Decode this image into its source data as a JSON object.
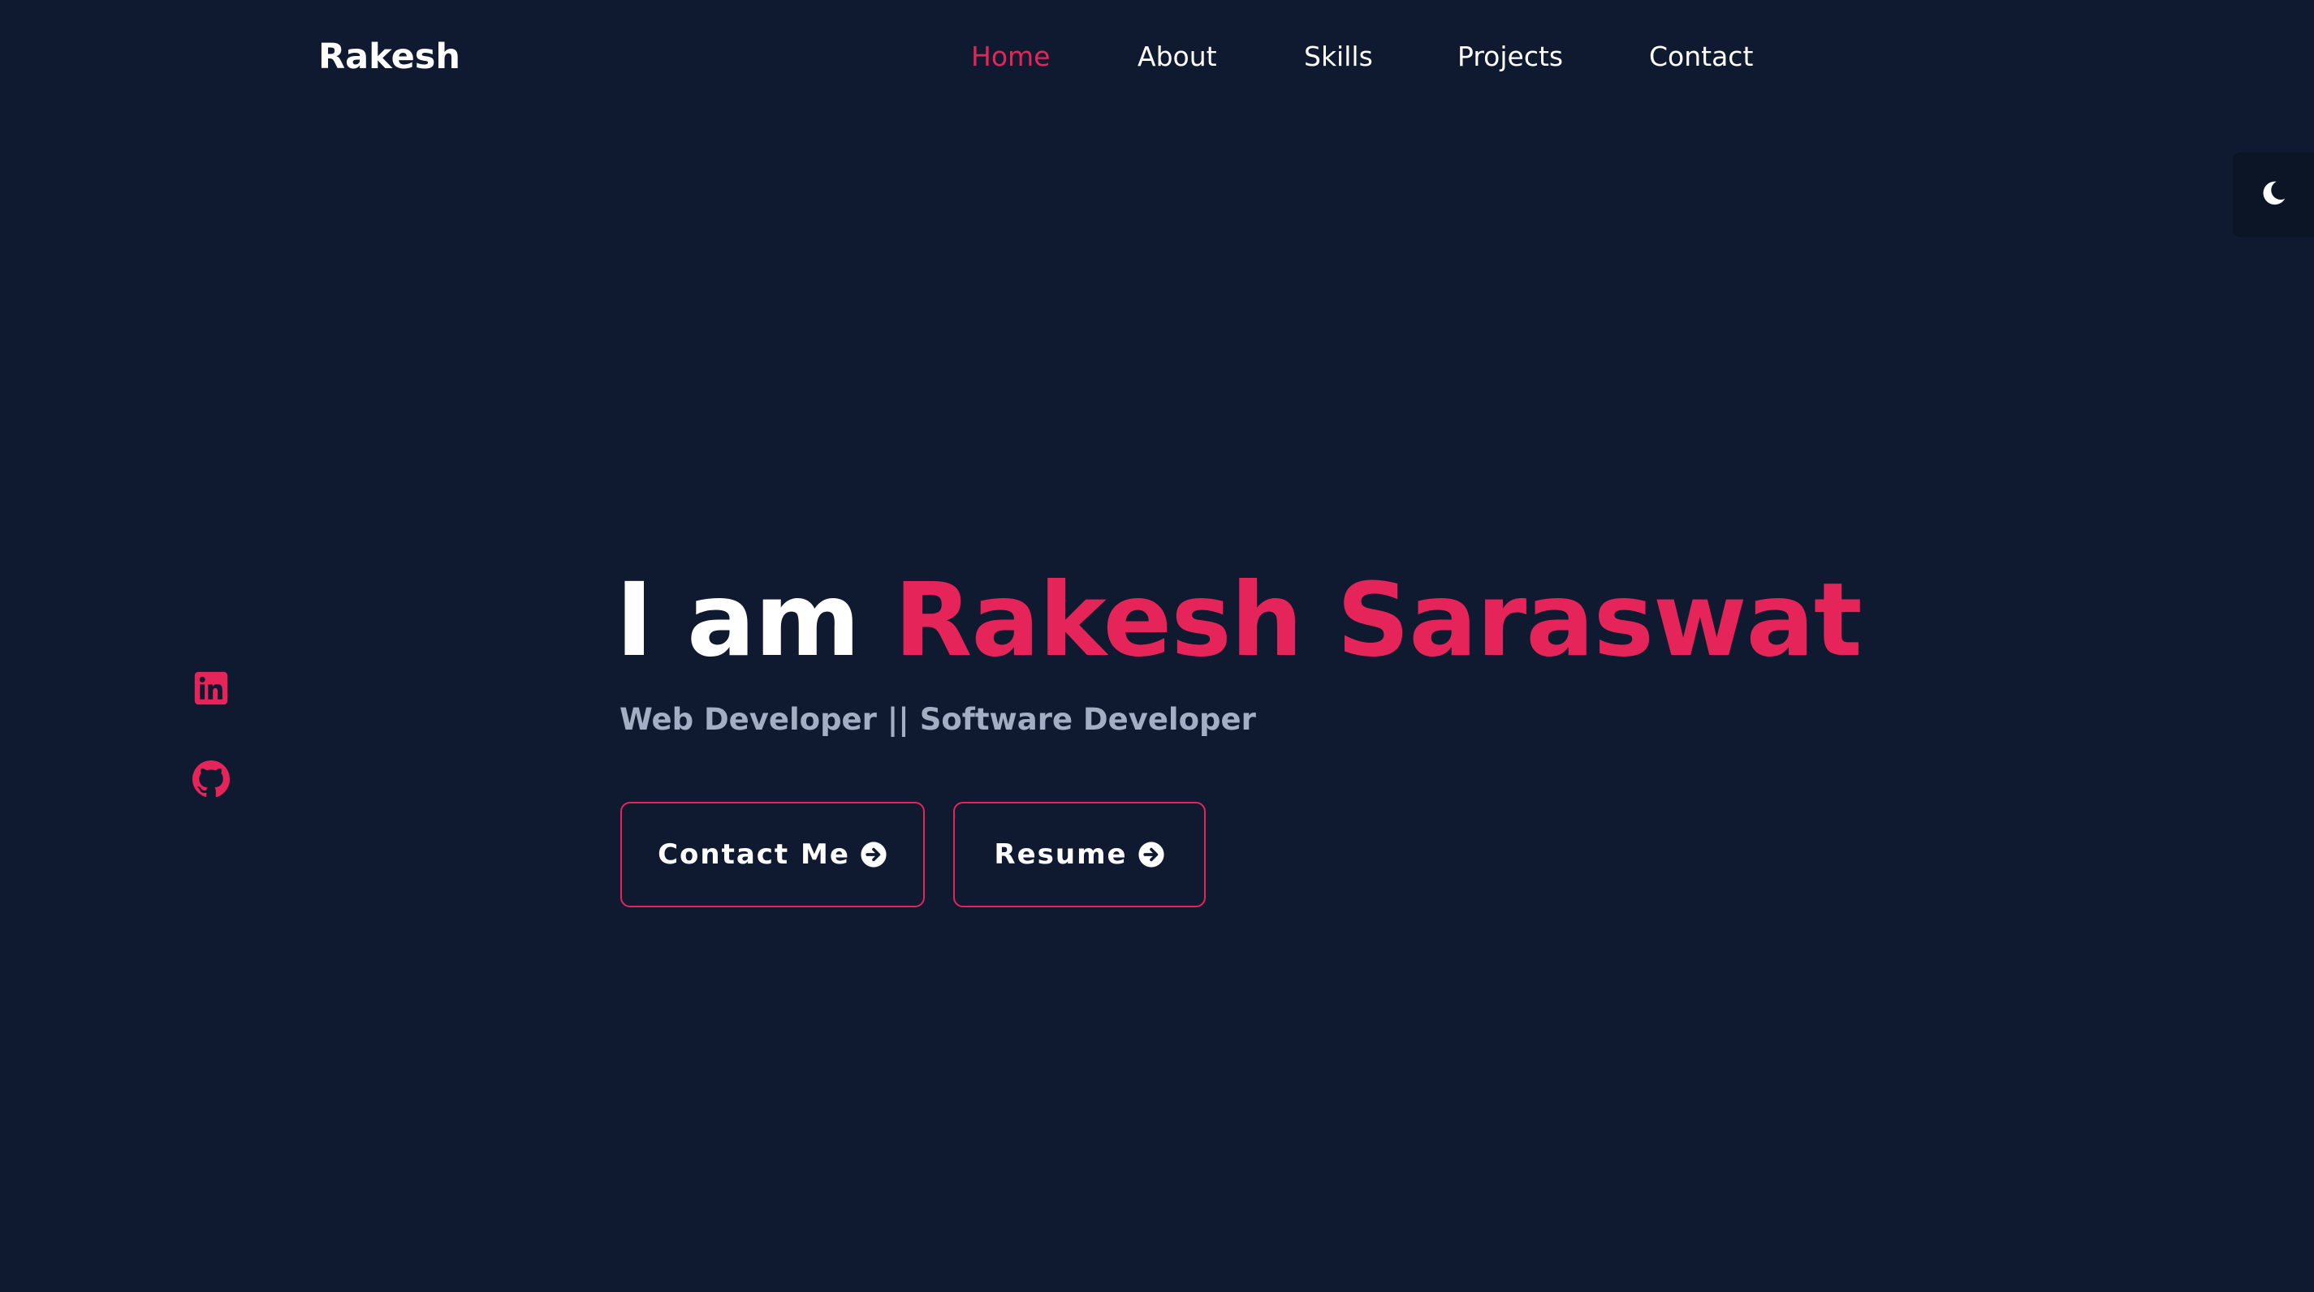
{
  "header": {
    "logo": "Rakesh",
    "nav": [
      {
        "label": "Home",
        "active": true
      },
      {
        "label": "About",
        "active": false
      },
      {
        "label": "Skills",
        "active": false
      },
      {
        "label": "Projects",
        "active": false
      },
      {
        "label": "Contact",
        "active": false
      }
    ]
  },
  "theme_toggle": {
    "icon": "moon-icon"
  },
  "social": [
    {
      "icon": "linkedin-icon"
    },
    {
      "icon": "github-icon"
    }
  ],
  "hero": {
    "title_prefix": "I am",
    "title_name": "Rakesh Saraswat",
    "subtitle": "Web Developer || Software Developer",
    "buttons": [
      {
        "label": "Contact Me",
        "icon": "arrow-right-circle-icon"
      },
      {
        "label": "Resume",
        "icon": "arrow-right-circle-icon"
      }
    ]
  },
  "colors": {
    "background": "#0f1a30",
    "accent": "#e5255a",
    "text": "#ffffff",
    "muted": "#a3aec3"
  }
}
